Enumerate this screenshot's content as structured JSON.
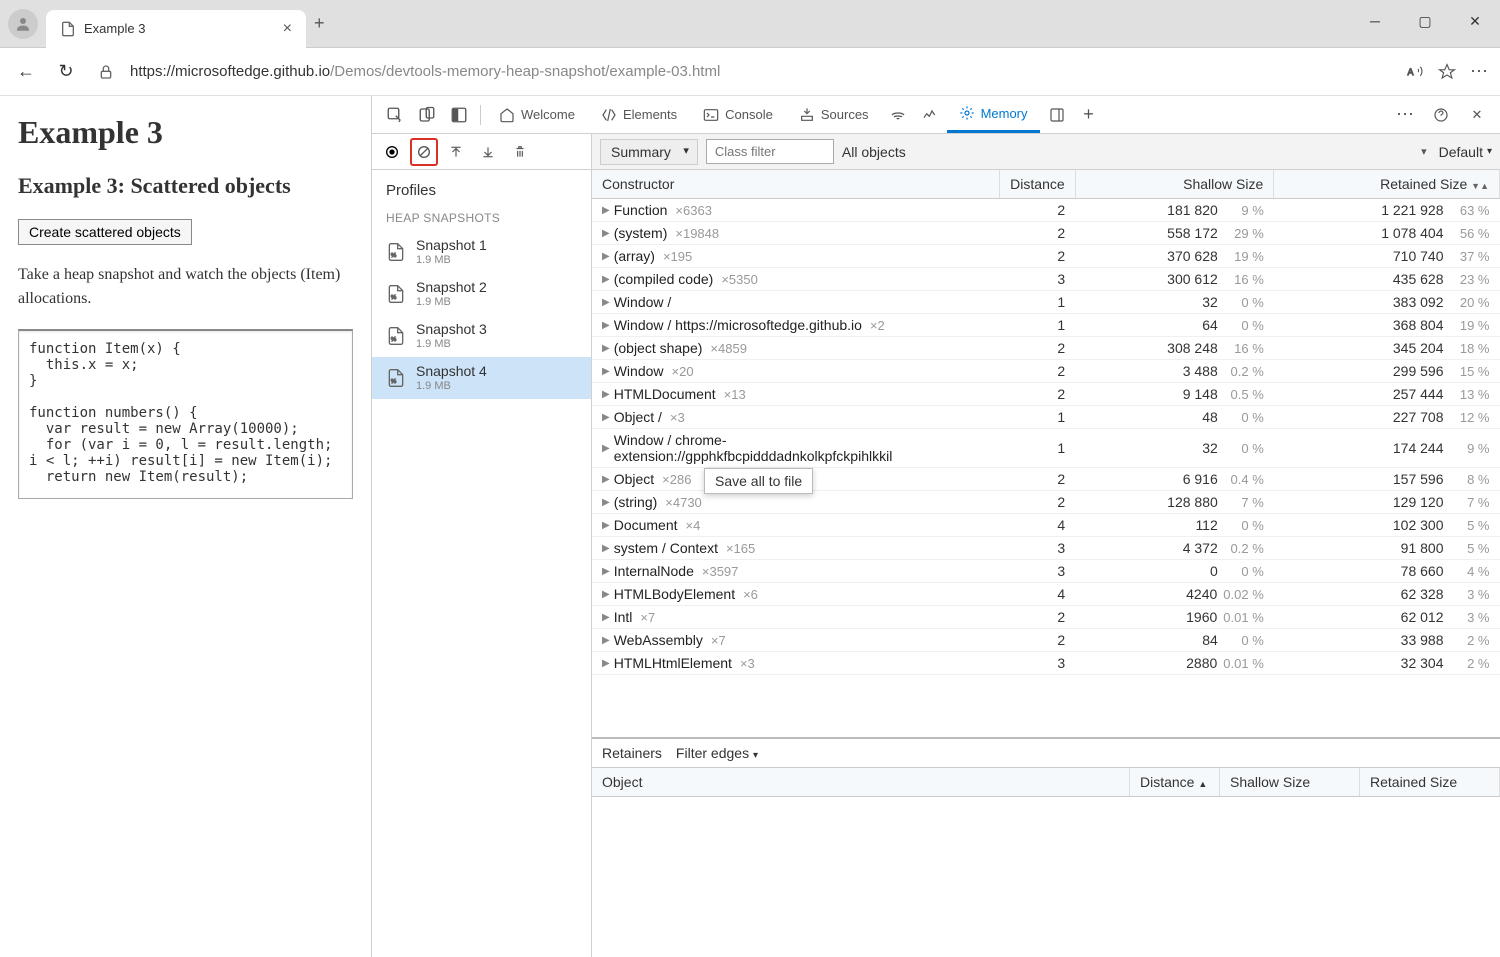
{
  "browser": {
    "tab_title": "Example 3",
    "url_domain": "https://microsoftedge.github.io",
    "url_path": "/Demos/devtools-memory-heap-snapshot/example-03.html"
  },
  "page": {
    "h1": "Example 3",
    "h2": "Example 3: Scattered objects",
    "button": "Create scattered objects",
    "description": "Take a heap snapshot and watch the objects (Item) allocations.",
    "code": "function Item(x) {\n  this.x = x;\n}\n\nfunction numbers() {\n  var result = new Array(10000);\n  for (var i = 0, l = result.length;\ni < l; ++i) result[i] = new Item(i);\n  return new Item(result);"
  },
  "devtools": {
    "tabs": {
      "welcome": "Welcome",
      "elements": "Elements",
      "console": "Console",
      "sources": "Sources",
      "memory": "Memory"
    },
    "profiles_label": "Profiles",
    "heap_section": "HEAP SNAPSHOTS",
    "snapshots": [
      {
        "name": "Snapshot 1",
        "size": "1.9 MB"
      },
      {
        "name": "Snapshot 2",
        "size": "1.9 MB"
      },
      {
        "name": "Snapshot 3",
        "size": "1.9 MB"
      },
      {
        "name": "Snapshot 4",
        "size": "1.9 MB"
      }
    ],
    "memory_toolbar": {
      "summary": "Summary",
      "filter_placeholder": "Class filter",
      "all_objects": "All objects",
      "default": "Default"
    },
    "headers": {
      "constructor": "Constructor",
      "distance": "Distance",
      "shallow": "Shallow Size",
      "retained": "Retained Size"
    },
    "context_menu": "Save all to file",
    "rows": [
      {
        "name": "Function",
        "count": "×6363",
        "distance": "2",
        "shallow": "181 820",
        "shallow_pct": "9 %",
        "retained": "1 221 928",
        "retained_pct": "63 %"
      },
      {
        "name": "(system)",
        "count": "×19848",
        "distance": "2",
        "shallow": "558 172",
        "shallow_pct": "29 %",
        "retained": "1 078 404",
        "retained_pct": "56 %"
      },
      {
        "name": "(array)",
        "count": "×195",
        "distance": "2",
        "shallow": "370 628",
        "shallow_pct": "19 %",
        "retained": "710 740",
        "retained_pct": "37 %"
      },
      {
        "name": "(compiled code)",
        "count": "×5350",
        "distance": "3",
        "shallow": "300 612",
        "shallow_pct": "16 %",
        "retained": "435 628",
        "retained_pct": "23 %"
      },
      {
        "name": "Window /",
        "count": "",
        "distance": "1",
        "shallow": "32",
        "shallow_pct": "0 %",
        "retained": "383 092",
        "retained_pct": "20 %"
      },
      {
        "name": "Window / https://microsoftedge.github.io",
        "count": "×2",
        "distance": "1",
        "shallow": "64",
        "shallow_pct": "0 %",
        "retained": "368 804",
        "retained_pct": "19 %"
      },
      {
        "name": "(object shape)",
        "count": "×4859",
        "distance": "2",
        "shallow": "308 248",
        "shallow_pct": "16 %",
        "retained": "345 204",
        "retained_pct": "18 %"
      },
      {
        "name": "Window",
        "count": "×20",
        "distance": "2",
        "shallow": "3 488",
        "shallow_pct": "0.2 %",
        "retained": "299 596",
        "retained_pct": "15 %"
      },
      {
        "name": "HTMLDocument",
        "count": "×13",
        "distance": "2",
        "shallow": "9 148",
        "shallow_pct": "0.5 %",
        "retained": "257 444",
        "retained_pct": "13 %"
      },
      {
        "name": "Object /",
        "count": "×3",
        "distance": "1",
        "shallow": "48",
        "shallow_pct": "0 %",
        "retained": "227 708",
        "retained_pct": "12 %"
      },
      {
        "name": "Window / chrome-extension://gpphkfbcpidddadnkolkpfckpihlkkil",
        "count": "",
        "distance": "1",
        "shallow": "32",
        "shallow_pct": "0 %",
        "retained": "174 244",
        "retained_pct": "9 %"
      },
      {
        "name": "Object",
        "count": "×286",
        "distance": "2",
        "shallow": "6 916",
        "shallow_pct": "0.4 %",
        "retained": "157 596",
        "retained_pct": "8 %"
      },
      {
        "name": "(string)",
        "count": "×4730",
        "distance": "2",
        "shallow": "128 880",
        "shallow_pct": "7 %",
        "retained": "129 120",
        "retained_pct": "7 %"
      },
      {
        "name": "Document",
        "count": "×4",
        "distance": "4",
        "shallow": "112",
        "shallow_pct": "0 %",
        "retained": "102 300",
        "retained_pct": "5 %"
      },
      {
        "name": "system / Context",
        "count": "×165",
        "distance": "3",
        "shallow": "4 372",
        "shallow_pct": "0.2 %",
        "retained": "91 800",
        "retained_pct": "5 %"
      },
      {
        "name": "InternalNode",
        "count": "×3597",
        "distance": "3",
        "shallow": "0",
        "shallow_pct": "0 %",
        "retained": "78 660",
        "retained_pct": "4 %"
      },
      {
        "name": "HTMLBodyElement",
        "count": "×6",
        "distance": "4",
        "shallow": "4240",
        "shallow_pct": "0.02 %",
        "retained": "62 328",
        "retained_pct": "3 %"
      },
      {
        "name": "Intl",
        "count": "×7",
        "distance": "2",
        "shallow": "1960",
        "shallow_pct": "0.01 %",
        "retained": "62 012",
        "retained_pct": "3 %"
      },
      {
        "name": "WebAssembly",
        "count": "×7",
        "distance": "2",
        "shallow": "84",
        "shallow_pct": "0 %",
        "retained": "33 988",
        "retained_pct": "2 %"
      },
      {
        "name": "HTMLHtmlElement",
        "count": "×3",
        "distance": "3",
        "shallow": "2880",
        "shallow_pct": "0.01 %",
        "retained": "32 304",
        "retained_pct": "2 %"
      }
    ],
    "retainers": {
      "label": "Retainers",
      "filter": "Filter edges",
      "headers": {
        "object": "Object",
        "distance": "Distance",
        "shallow": "Shallow Size",
        "retained": "Retained Size"
      }
    }
  }
}
